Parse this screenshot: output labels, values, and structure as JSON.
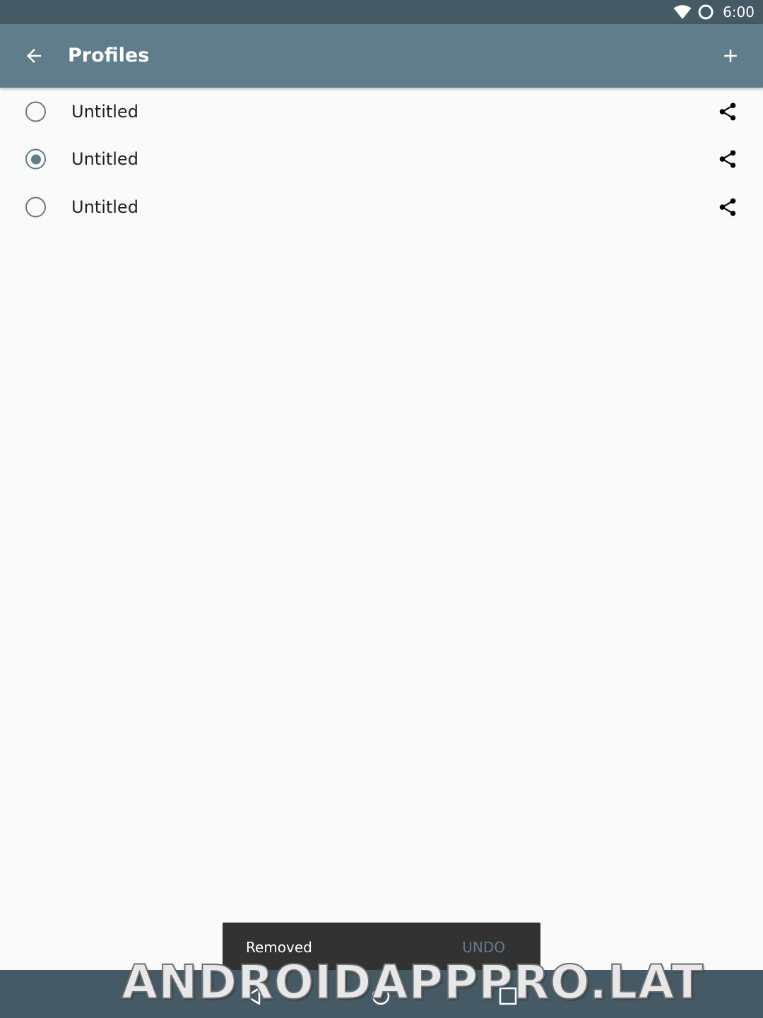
{
  "status_bar": {
    "time": "6:00",
    "icons": [
      "wifi-icon",
      "sync-icon"
    ]
  },
  "app_bar": {
    "title": "Profiles",
    "back_icon": "arrow-back-icon",
    "add_icon": "add-icon"
  },
  "profiles": [
    {
      "name": "Untitled",
      "selected": false
    },
    {
      "name": "Untitled",
      "selected": true
    },
    {
      "name": "Untitled",
      "selected": false
    }
  ],
  "snackbar": {
    "message": "Removed",
    "action": "UNDO"
  },
  "nav_bar": {
    "icons": [
      "nav-back-icon",
      "nav-home-icon",
      "nav-recents-icon"
    ]
  },
  "watermark": "ANDROIDAPPPRO.LAT",
  "colors": {
    "primary": "#607d8b",
    "primary_dark": "#455a64",
    "background": "#fafafa",
    "snackbar": "#323232"
  }
}
